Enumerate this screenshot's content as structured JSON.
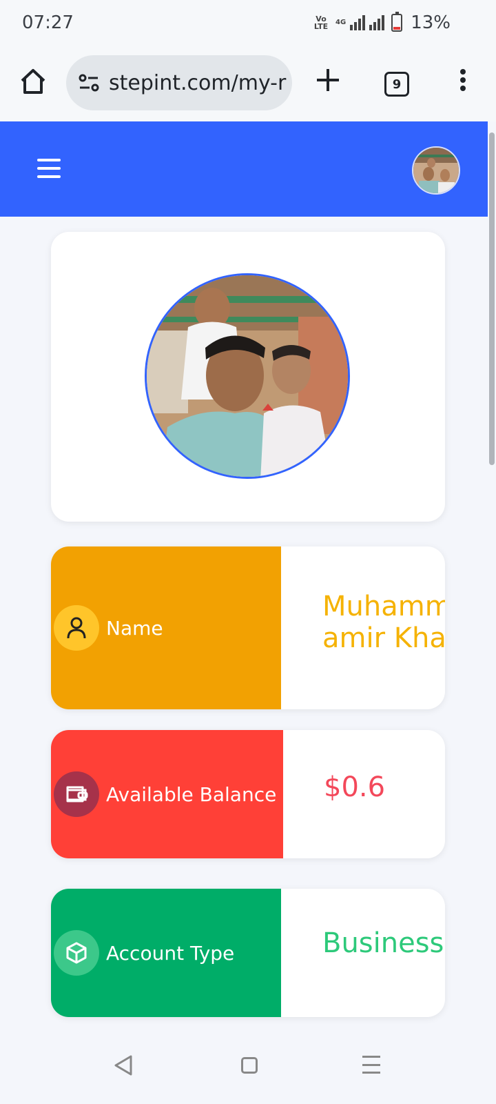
{
  "status_bar": {
    "time": "07:27",
    "network_label": "Vo LTE",
    "network_type": "4G",
    "battery_percent": "13%"
  },
  "browser": {
    "url": "stepint.com/my-r",
    "tab_count": "9",
    "icons": [
      "home-icon",
      "site-settings-icon",
      "plus-icon",
      "tab-switcher-icon",
      "more-vert-icon"
    ]
  },
  "header": {
    "icons": [
      "hamburger-menu-icon",
      "avatar"
    ],
    "accent_color": "#3263fe"
  },
  "profile": {
    "rows": [
      {
        "label": "Name",
        "value": "Muhammad amir Khan",
        "value_lines": [
          "Muhamm",
          "amir Khar"
        ],
        "icon": "user-icon",
        "color": "#f2a102"
      },
      {
        "label": "Available Balance",
        "value": "$0.6",
        "icon": "wallet-icon",
        "color": "#ff4037"
      },
      {
        "label": "Account Type",
        "value": "Business",
        "icon": "package-icon",
        "color": "#00ad68"
      }
    ]
  },
  "nav_bar": {
    "icons": [
      "back-icon",
      "home-square-icon",
      "recents-icon"
    ]
  }
}
